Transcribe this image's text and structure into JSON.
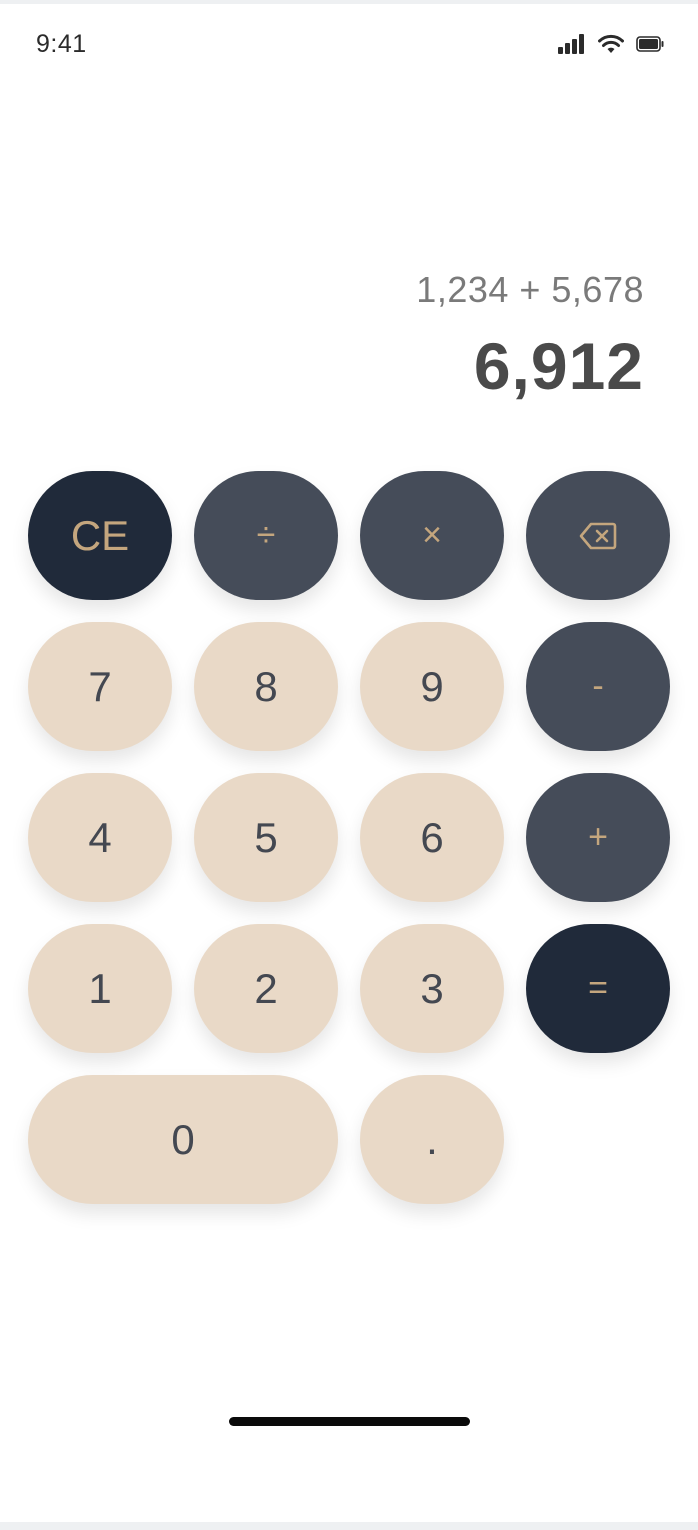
{
  "status_bar": {
    "time": "9:41",
    "icons": [
      "signal-icon",
      "wifi-icon",
      "battery-icon"
    ]
  },
  "display": {
    "expression": "1,234 + 5,678",
    "result": "6,912"
  },
  "keypad": {
    "clear_entry": "CE",
    "divide": "÷",
    "multiply": "×",
    "backspace_icon": "backspace-icon",
    "seven": "7",
    "eight": "8",
    "nine": "9",
    "subtract": "-",
    "four": "4",
    "five": "5",
    "six": "6",
    "add": "+",
    "one": "1",
    "two": "2",
    "three": "3",
    "equals": "=",
    "zero": "0",
    "decimal": "."
  },
  "colors": {
    "number_key": "#e9d9c7",
    "operator_key": "#454c59",
    "dark_key": "#202a3a",
    "operator_text": "#c4a67e",
    "number_text": "#444851"
  }
}
